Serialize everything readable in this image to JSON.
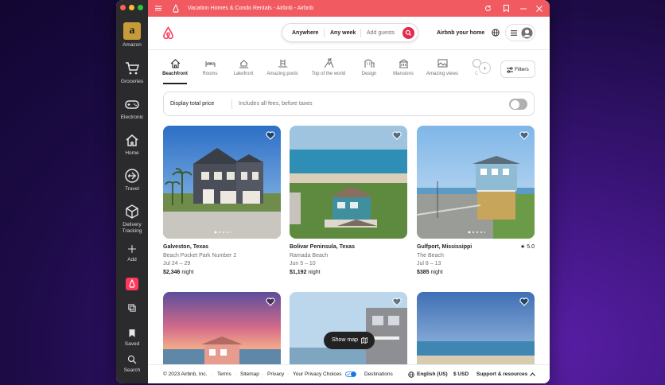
{
  "window": {
    "title": "Vacation Homes & Condo Rentals - Airbnb - Airbnb"
  },
  "sidebar": {
    "items": [
      {
        "label": "Amazon",
        "icon": "amazon-icon"
      },
      {
        "label": "Groceries",
        "icon": "cart-icon"
      },
      {
        "label": "Electronic",
        "icon": "gamepad-icon"
      },
      {
        "label": "Home",
        "icon": "home-icon"
      },
      {
        "label": "Travel",
        "icon": "plane-icon"
      },
      {
        "label": "Delivery Tracking",
        "icon": "box-icon"
      },
      {
        "label": "Add",
        "icon": "plus-icon"
      },
      {
        "label": "Saved",
        "icon": "bookmark-icon"
      },
      {
        "label": "Search",
        "icon": "search-icon"
      }
    ]
  },
  "header": {
    "search": {
      "anywhere": "Anywhere",
      "any_week": "Any week",
      "add_guests": "Add guests"
    },
    "host_label": "Airbnb your home"
  },
  "categories": [
    {
      "label": "Beachfront",
      "active": true
    },
    {
      "label": "Rooms"
    },
    {
      "label": "Lakefront"
    },
    {
      "label": "Amazing pools"
    },
    {
      "label": "Top of the world"
    },
    {
      "label": "Design"
    },
    {
      "label": "Mansions"
    },
    {
      "label": "Amazing views"
    },
    {
      "label": "C"
    }
  ],
  "filters_label": "Filters",
  "price_bar": {
    "title": "Display total price",
    "subtitle": "Includes all fees, before taxes"
  },
  "listings": [
    {
      "location": "Galveston, Texas",
      "name": "Beach Pocket Park Number 2",
      "dates": "Jul 24 – 29",
      "price": "$2,346",
      "unit": "night"
    },
    {
      "location": "Bolivar Peninsula, Texas",
      "name": "Ramada Beach",
      "dates": "Jun 5 – 10",
      "price": "$1,192",
      "unit": "night"
    },
    {
      "location": "Gulfport, Mississippi",
      "name": "The Beach",
      "dates": "Jul 8 – 13",
      "price": "$385",
      "unit": "night",
      "rating": "5.0"
    }
  ],
  "show_map": "Show map",
  "footer": {
    "copyright": "© 2023 Airbnb, Inc.",
    "links": [
      "Terms",
      "Sitemap",
      "Privacy",
      "Your Privacy Choices",
      "Destinations"
    ],
    "language": "English (US)",
    "currency": "$  USD",
    "support": "Support & resources"
  },
  "colors": {
    "brand": "#ff385c",
    "titlebar": "#f15a60",
    "sidebar": "#2b2b2d"
  }
}
